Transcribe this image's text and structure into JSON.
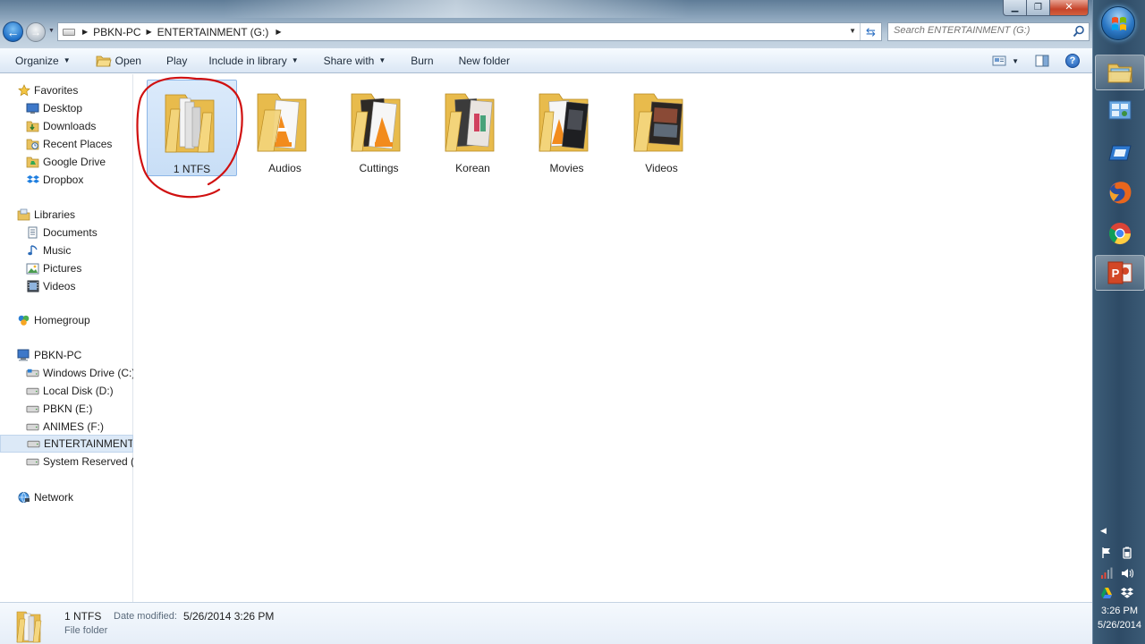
{
  "address": {
    "crumbs": [
      "PBKN-PC",
      "ENTERTAINMENT (G:)"
    ]
  },
  "search": {
    "placeholder": "Search ENTERTAINMENT (G:)"
  },
  "toolbar": {
    "organize": "Organize",
    "open": "Open",
    "play": "Play",
    "include_in_library": "Include in library",
    "share_with": "Share with",
    "burn": "Burn",
    "new_folder": "New folder"
  },
  "nav": {
    "favorites": {
      "label": "Favorites",
      "items": [
        "Desktop",
        "Downloads",
        "Recent Places",
        "Google Drive",
        "Dropbox"
      ]
    },
    "libraries": {
      "label": "Libraries",
      "items": [
        "Documents",
        "Music",
        "Pictures",
        "Videos"
      ]
    },
    "homegroup": "Homegroup",
    "computer": {
      "label": "PBKN-PC",
      "items": [
        "Windows Drive (C:)",
        "Local Disk (D:)",
        "PBKN (E:)",
        "ANIMES (F:)",
        "ENTERTAINMENT (G:)",
        "System Reserved (J:)"
      ]
    },
    "network": "Network"
  },
  "folders": [
    {
      "name": "1 NTFS",
      "selected": true
    },
    {
      "name": "Audios"
    },
    {
      "name": "Cuttings"
    },
    {
      "name": "Korean"
    },
    {
      "name": "Movies"
    },
    {
      "name": "Videos"
    }
  ],
  "details": {
    "name": "1 NTFS",
    "date_label": "Date modified:",
    "date": "5/26/2014 3:26 PM",
    "type": "File folder"
  },
  "clock": {
    "time": "3:26 PM",
    "date": "5/26/2014"
  },
  "colors": {
    "selection": "#cce0f7",
    "annotation": "#d01010",
    "folder": "#f2cf6e"
  }
}
